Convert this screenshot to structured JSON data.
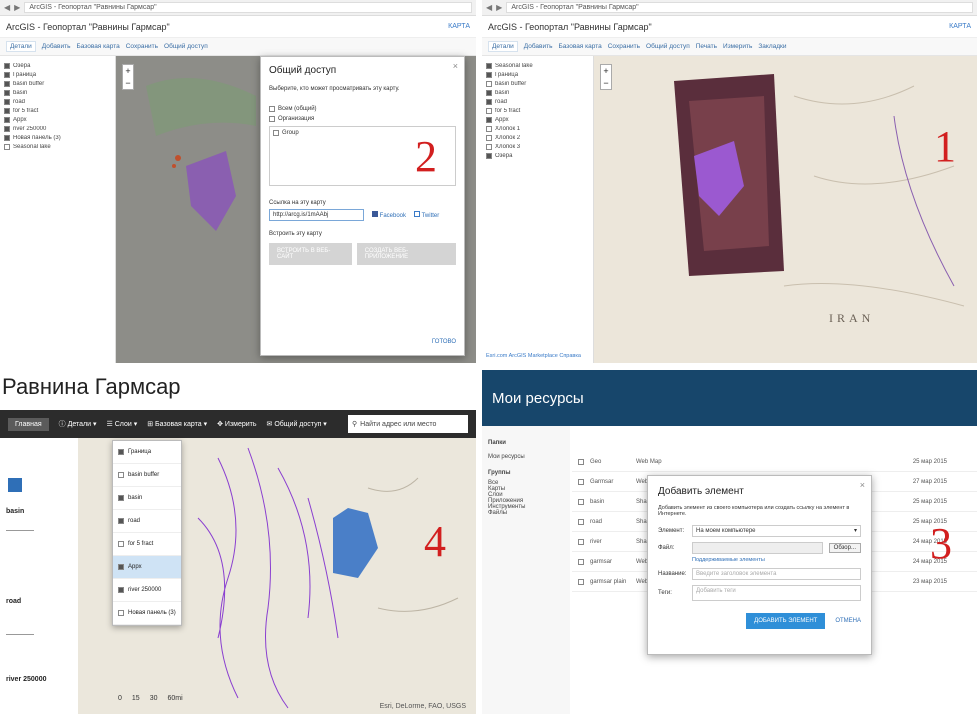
{
  "markers": {
    "one": "1",
    "two": "2",
    "three": "3",
    "four": "4"
  },
  "browser": {
    "url_left": "ArcGIS - Геопортал \"Равнины Гармсар\"",
    "url_right": "ArcGIS - Геопортал \"Равнины Гармсар\""
  },
  "app": {
    "title": "ArcGIS - Геопортал \"Равнины Гармсар\"",
    "map_link": "КАРТА"
  },
  "toolbar": [
    "Детали",
    "Добавить",
    "Базовая карта",
    "Сохранить",
    "Общий доступ",
    "Печать",
    "Измерить",
    "Закладки"
  ],
  "share_dialog": {
    "title": "Общий доступ",
    "subtitle": "Выберите, кто может просматривать эту карту.",
    "option_everyone": "Всем (общий)",
    "option_group": "Организация",
    "group_item": "Group",
    "link_label": "Ссылка на эту карту",
    "link_value": "http://arcg.is/1mAAbj",
    "facebook": "Facebook",
    "twitter": "Twitter",
    "embed_label": "Встроить эту карту",
    "btn_embed": "ВСТРОИТЬ В ВЕБ-САЙТ",
    "btn_app": "СОЗДАТЬ ВЕБ-ПРИЛОЖЕНИЕ",
    "done": "ГОТОВО"
  },
  "sidebar_layers": [
    "Озёра",
    "Граница",
    "basin buffer",
    "basin",
    "road",
    "for 5 fract",
    "Appx",
    "river 250000",
    "Новая панель (3)",
    "Seasonal lake",
    "Хлопок 1",
    "Хлопок 2",
    "Хлопок 3"
  ],
  "sidebar_footer": "Esri.com  ArcGIS Marketplace  Справка",
  "map_label_iran": "IRAN",
  "panel3": {
    "title": "Равнина Гармсар",
    "home": "Главная",
    "menu_details": "Детали",
    "menu_layers": "Слои",
    "menu_basemap": "Базовая карта",
    "menu_measure": "Измерить",
    "menu_share": "Общий доступ",
    "search_placeholder": "Найти адрес или место",
    "layers": [
      "Граница",
      "basin buffer",
      "basin",
      "road",
      "for 5 fract",
      "Appx",
      "river 250000",
      "Новая панель (3)"
    ],
    "legend": [
      "basin",
      "road",
      "river 250000"
    ],
    "scale": [
      "0",
      "15",
      "30",
      "60mi"
    ],
    "attribution": "Esri, DeLorme, FAO, USGS"
  },
  "panel4": {
    "banner": "Мои ресурсы",
    "sidebar": [
      "Папки",
      "Мои ресурсы",
      "Группы"
    ],
    "categories": [
      "Все",
      "Карты",
      "Слои",
      "Приложения",
      "Инструменты",
      "Файлы"
    ],
    "modal_title": "Добавить элемент",
    "modal_desc": "Добавить элемент из своего компьютера или создать ссылку на элемент в Интернете.",
    "label_item": "Элемент:",
    "item_value": "На моем компьютере",
    "label_file": "Файл:",
    "browse": "Обзор...",
    "supported": "Поддерживаемые элементы",
    "label_title": "Название:",
    "title_placeholder": "Введите заголовок элемента",
    "label_tags": "Теги:",
    "tags_placeholder": "Добавить теги",
    "btn_add": "ДОБАВИТЬ ЭЛЕМЕНТ",
    "btn_cancel": "ОТМЕНА",
    "rows": [
      {
        "name": "Geo",
        "type": "Web Map",
        "date": "25 мар 2015"
      },
      {
        "name": "Garmsar",
        "type": "Web Map",
        "date": "27 мар 2015"
      },
      {
        "name": "basin",
        "type": "Shapefile",
        "date": "25 мар 2015"
      },
      {
        "name": "road",
        "type": "Shapefile",
        "date": "25 мар 2015"
      },
      {
        "name": "river",
        "type": "Shapefile",
        "date": "24 мар 2015"
      },
      {
        "name": "garmsar",
        "type": "Web Map",
        "date": "24 мар 2015"
      },
      {
        "name": "garmsar plain",
        "type": "Web Map",
        "date": "23 мар 2015"
      }
    ]
  },
  "colors": {
    "marker": "#d21f1f",
    "banner": "#17466b",
    "accent": "#2f8fd8",
    "polygon": "#9b59d0"
  }
}
